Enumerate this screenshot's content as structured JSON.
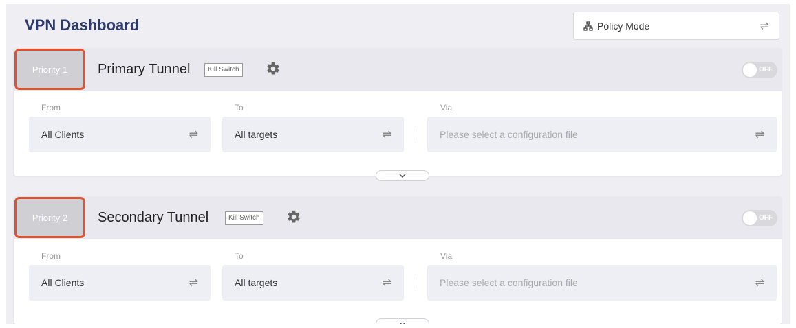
{
  "header": {
    "title": "VPN Dashboard",
    "mode_select": {
      "icon": "policy-tree-icon",
      "value": "Policy Mode",
      "action_icon": "swap-arrows-icon"
    }
  },
  "tunnels": [
    {
      "priority": "Priority 1",
      "name": "Primary Tunnel",
      "kill_switch": "Kill Switch",
      "toggle_label": "OFF",
      "enabled": false,
      "from_label": "From",
      "from_value": "All Clients",
      "to_label": "To",
      "to_value": "All targets",
      "via_label": "Via",
      "via_placeholder": "Please select a configuration file"
    },
    {
      "priority": "Priority 2",
      "name": "Secondary Tunnel",
      "kill_switch": "Kill Switch",
      "toggle_label": "OFF",
      "enabled": false,
      "from_label": "From",
      "from_value": "All Clients",
      "to_label": "To",
      "to_value": "All targets",
      "via_label": "Via",
      "via_placeholder": "Please select a configuration file"
    }
  ],
  "colors": {
    "title": "#2d3a6b",
    "highlight_outline": "#e2512d",
    "priority_badge": "#cfcfd4"
  }
}
